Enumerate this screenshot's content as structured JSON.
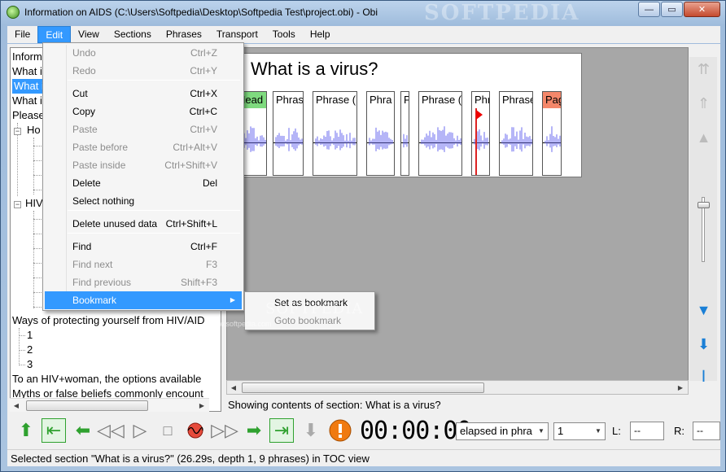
{
  "window": {
    "title": "Information on AIDS (C:\\Users\\Softpedia\\Desktop\\Softpedia Test\\project.obi) - Obi",
    "watermark": "SOFTPEDIA",
    "watermark_url": "www.softpedia.com",
    "minimize_glyph": "—",
    "maximize_glyph": "▭",
    "close_glyph": "✕"
  },
  "menubar": {
    "items": [
      "File",
      "Edit",
      "View",
      "Sections",
      "Phrases",
      "Transport",
      "Tools",
      "Help"
    ],
    "active": "Edit"
  },
  "edit_menu": {
    "items": [
      {
        "label": "Undo",
        "shortcut": "Ctrl+Z",
        "enabled": false
      },
      {
        "label": "Redo",
        "shortcut": "Ctrl+Y",
        "enabled": false
      },
      {
        "label": "Cut",
        "shortcut": "Ctrl+X",
        "enabled": true
      },
      {
        "label": "Copy",
        "shortcut": "Ctrl+C",
        "enabled": true
      },
      {
        "label": "Paste",
        "shortcut": "Ctrl+V",
        "enabled": false
      },
      {
        "label": "Paste before",
        "shortcut": "Ctrl+Alt+V",
        "enabled": false
      },
      {
        "label": "Paste inside",
        "shortcut": "Ctrl+Shift+V",
        "enabled": false
      },
      {
        "label": "Delete",
        "shortcut": "Del",
        "enabled": true
      },
      {
        "label": "Select nothing",
        "shortcut": "",
        "enabled": true
      },
      {
        "label": "Delete unused data",
        "shortcut": "Ctrl+Shift+L",
        "enabled": true
      },
      {
        "label": "Find",
        "shortcut": "Ctrl+F",
        "enabled": true
      },
      {
        "label": "Find next",
        "shortcut": "F3",
        "enabled": false
      },
      {
        "label": "Find previous",
        "shortcut": "Shift+F3",
        "enabled": false
      },
      {
        "label": "Bookmark",
        "shortcut": "",
        "enabled": true,
        "highlighted": true,
        "submenu": true
      }
    ]
  },
  "bookmark_submenu": {
    "items": [
      {
        "label": "Set as bookmark",
        "enabled": true
      },
      {
        "label": "Goto bookmark",
        "enabled": false
      }
    ]
  },
  "toc": {
    "visible_lines": [
      {
        "text": "Inform",
        "selected": false
      },
      {
        "text": "What i",
        "selected": false
      },
      {
        "text": "What i",
        "selected": true
      },
      {
        "text": "What i",
        "selected": false
      },
      {
        "text": "Please",
        "selected": false
      },
      {
        "text": "Ho",
        "selected": false
      },
      {
        "text": "HIV",
        "selected": false
      },
      {
        "text": "Ways of protecting yourself from HIV/AID",
        "selected": false
      },
      {
        "text": "1",
        "selected": false
      },
      {
        "text": "2",
        "selected": false
      },
      {
        "text": "3",
        "selected": false
      },
      {
        "text": "To an HIV+woman, the options available",
        "selected": false
      },
      {
        "text": "Myths or false beliefs commonly encount",
        "selected": false
      }
    ],
    "expander_glyph": "−"
  },
  "content": {
    "section_title": "What is a virus?",
    "blocks": [
      {
        "label": "Head",
        "color": "#7fdb7f"
      },
      {
        "label": "Phras",
        "color": "#ffffff"
      },
      {
        "label": "Phrase (",
        "color": "#ffffff"
      },
      {
        "label": "Phra",
        "color": "#ffffff"
      },
      {
        "label": "P",
        "color": "#ffffff"
      },
      {
        "label": "Phrase (",
        "color": "#ffffff"
      },
      {
        "label": "Phr",
        "color": "#ffffff"
      },
      {
        "label": "Phrase",
        "color": "#ffffff"
      },
      {
        "label": "Pag",
        "color": "#f4876a"
      }
    ],
    "status_text": "Showing contents of section:  What is a virus?"
  },
  "right_tools": {
    "icons": [
      "up-arrow-gray-icon",
      "up-arrow-gray-icon",
      "triangle-gray-icon",
      "down-triangle-blue-icon",
      "down-arrow-blue-icon"
    ]
  },
  "transport": {
    "time": "00:00:00",
    "time_mode": "elapsed in phra",
    "level_value": "1",
    "left_label": "L:",
    "right_label": "R:",
    "left_value": "--",
    "right_value": "--"
  },
  "statusbar": {
    "text": "Selected section \"What is a virus?\" (26.29s, depth 1, 9 phrases) in TOC view"
  },
  "colors": {
    "accent": "#3399ff",
    "record": "#e86a10"
  }
}
